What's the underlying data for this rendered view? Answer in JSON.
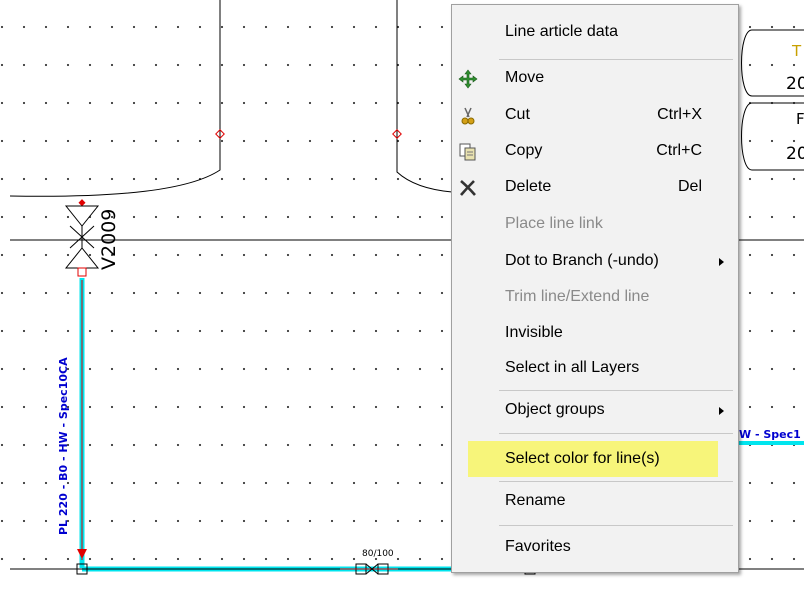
{
  "diagram": {
    "valve_tag": "V2009",
    "pipe_label_vertical": "PL 220 - B0 - HW - Spec10CA",
    "pipe_label_right": "W - Spec1",
    "reducer_label": "80/100",
    "right_box_1": {
      "top": "T",
      "bottom": "20"
    },
    "right_box_2": {
      "top": "F",
      "bottom": "20"
    },
    "colors": {
      "pipe": "#00e5ee",
      "marker": "#e00000",
      "label": "#0000d0"
    }
  },
  "context_menu": {
    "items": [
      {
        "id": "line-article-data",
        "label": "Line article data",
        "shortcut": "",
        "enabled": true,
        "icon": ""
      },
      {
        "id": "move",
        "label": "Move",
        "shortcut": "",
        "enabled": true,
        "icon": "move-icon"
      },
      {
        "id": "cut",
        "label": "Cut",
        "shortcut": "Ctrl+X",
        "enabled": true,
        "icon": "scissors-icon"
      },
      {
        "id": "copy",
        "label": "Copy",
        "shortcut": "Ctrl+C",
        "enabled": true,
        "icon": "copy-icon"
      },
      {
        "id": "delete",
        "label": "Delete",
        "shortcut": "Del",
        "enabled": true,
        "icon": "delete-x-icon"
      },
      {
        "id": "place-line-link",
        "label": "Place line link",
        "shortcut": "",
        "enabled": false
      },
      {
        "id": "dot-to-branch",
        "label": "Dot to Branch (-undo)",
        "shortcut": "",
        "enabled": true,
        "submenu": true
      },
      {
        "id": "trim-line",
        "label": "Trim line/Extend line",
        "shortcut": "",
        "enabled": false
      },
      {
        "id": "invisible",
        "label": "Invisible",
        "shortcut": "",
        "enabled": true
      },
      {
        "id": "select-all-layers",
        "label": "Select in all Layers",
        "shortcut": "",
        "enabled": true
      },
      {
        "id": "object-groups",
        "label": "Object groups",
        "shortcut": "",
        "enabled": true,
        "submenu": true
      },
      {
        "id": "select-color",
        "label": "Select color for line(s)",
        "shortcut": "",
        "enabled": true,
        "highlighted": true,
        "highlight_color": "#f7f57a"
      },
      {
        "id": "rename",
        "label": "Rename",
        "shortcut": "",
        "enabled": true
      },
      {
        "id": "favorites",
        "label": "Favorites",
        "shortcut": "",
        "enabled": true
      }
    ]
  }
}
